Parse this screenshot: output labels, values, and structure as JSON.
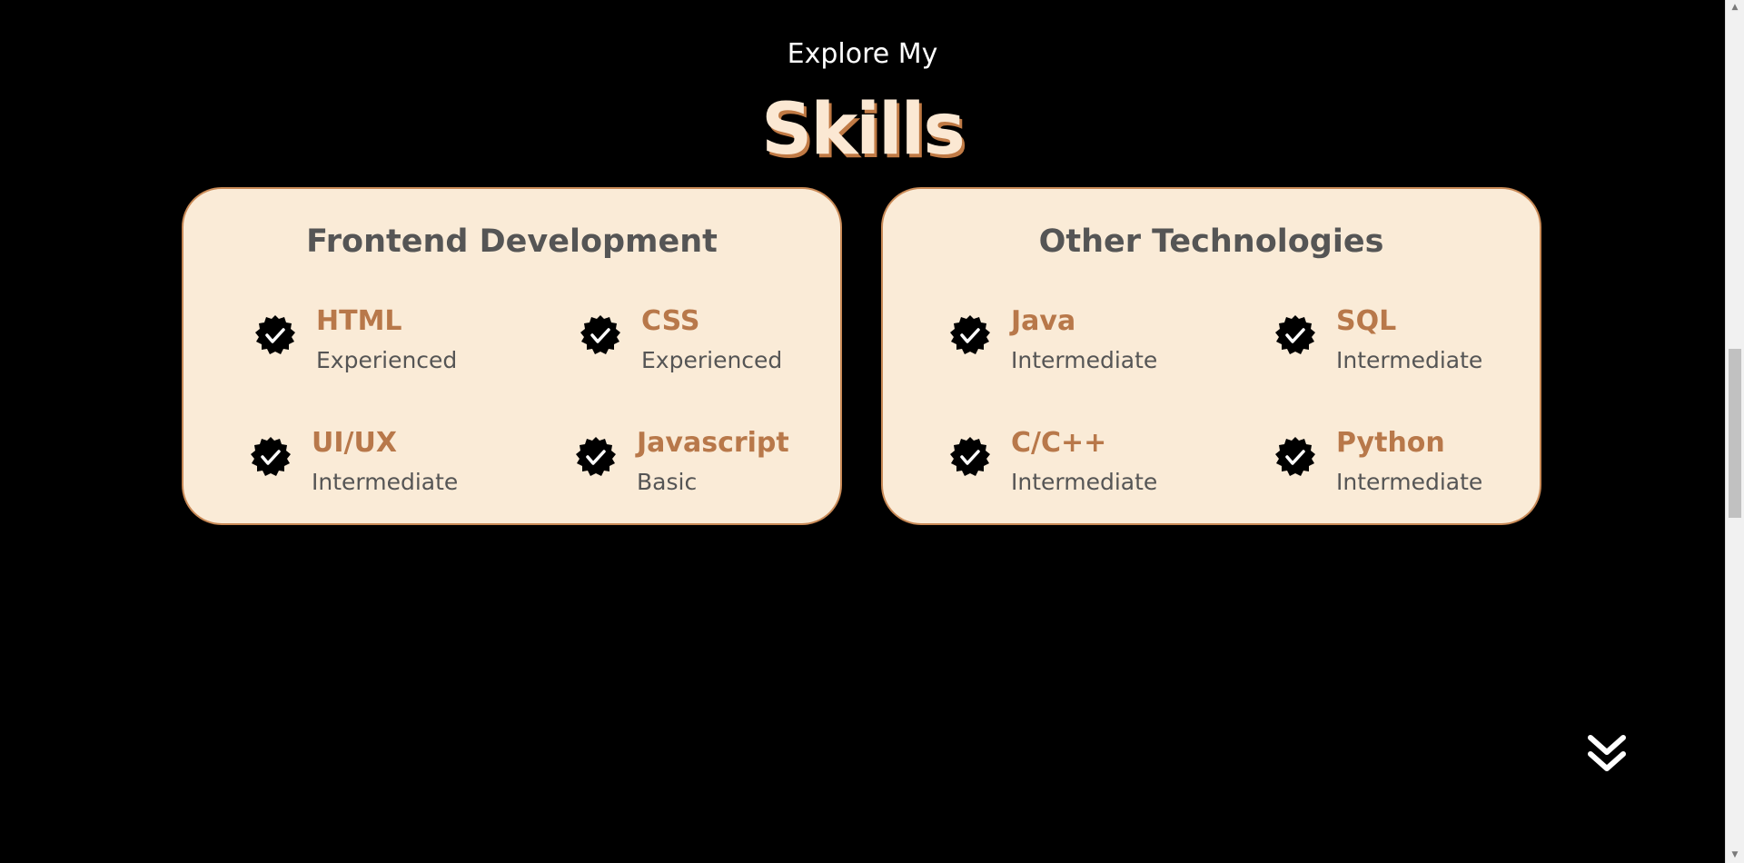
{
  "header": {
    "subtitle": "Explore My",
    "title": "Skills"
  },
  "sections": [
    {
      "title": "Frontend Development",
      "skills": [
        {
          "name": "HTML",
          "level": "Experienced"
        },
        {
          "name": "CSS",
          "level": "Experienced"
        },
        {
          "name": "UI/UX",
          "level": "Intermediate"
        },
        {
          "name": "Javascript",
          "level": "Basic"
        }
      ]
    },
    {
      "title": "Other Technologies",
      "skills": [
        {
          "name": "Java",
          "level": "Intermediate"
        },
        {
          "name": "SQL",
          "level": "Intermediate"
        },
        {
          "name": "C/C++",
          "level": "Intermediate"
        },
        {
          "name": "Python",
          "level": "Intermediate"
        }
      ]
    }
  ],
  "icons": {
    "skill_badge": "checkmark-badge-icon",
    "scroll_down": "double-chevron-down-icon"
  },
  "colors": {
    "background": "#000000",
    "card_background": "#faebd7",
    "card_border": "#c98a57",
    "accent": "#b8784a",
    "title_fill": "#fbe8d3",
    "title_shadow": "#c07a45",
    "text_muted": "#555555"
  }
}
